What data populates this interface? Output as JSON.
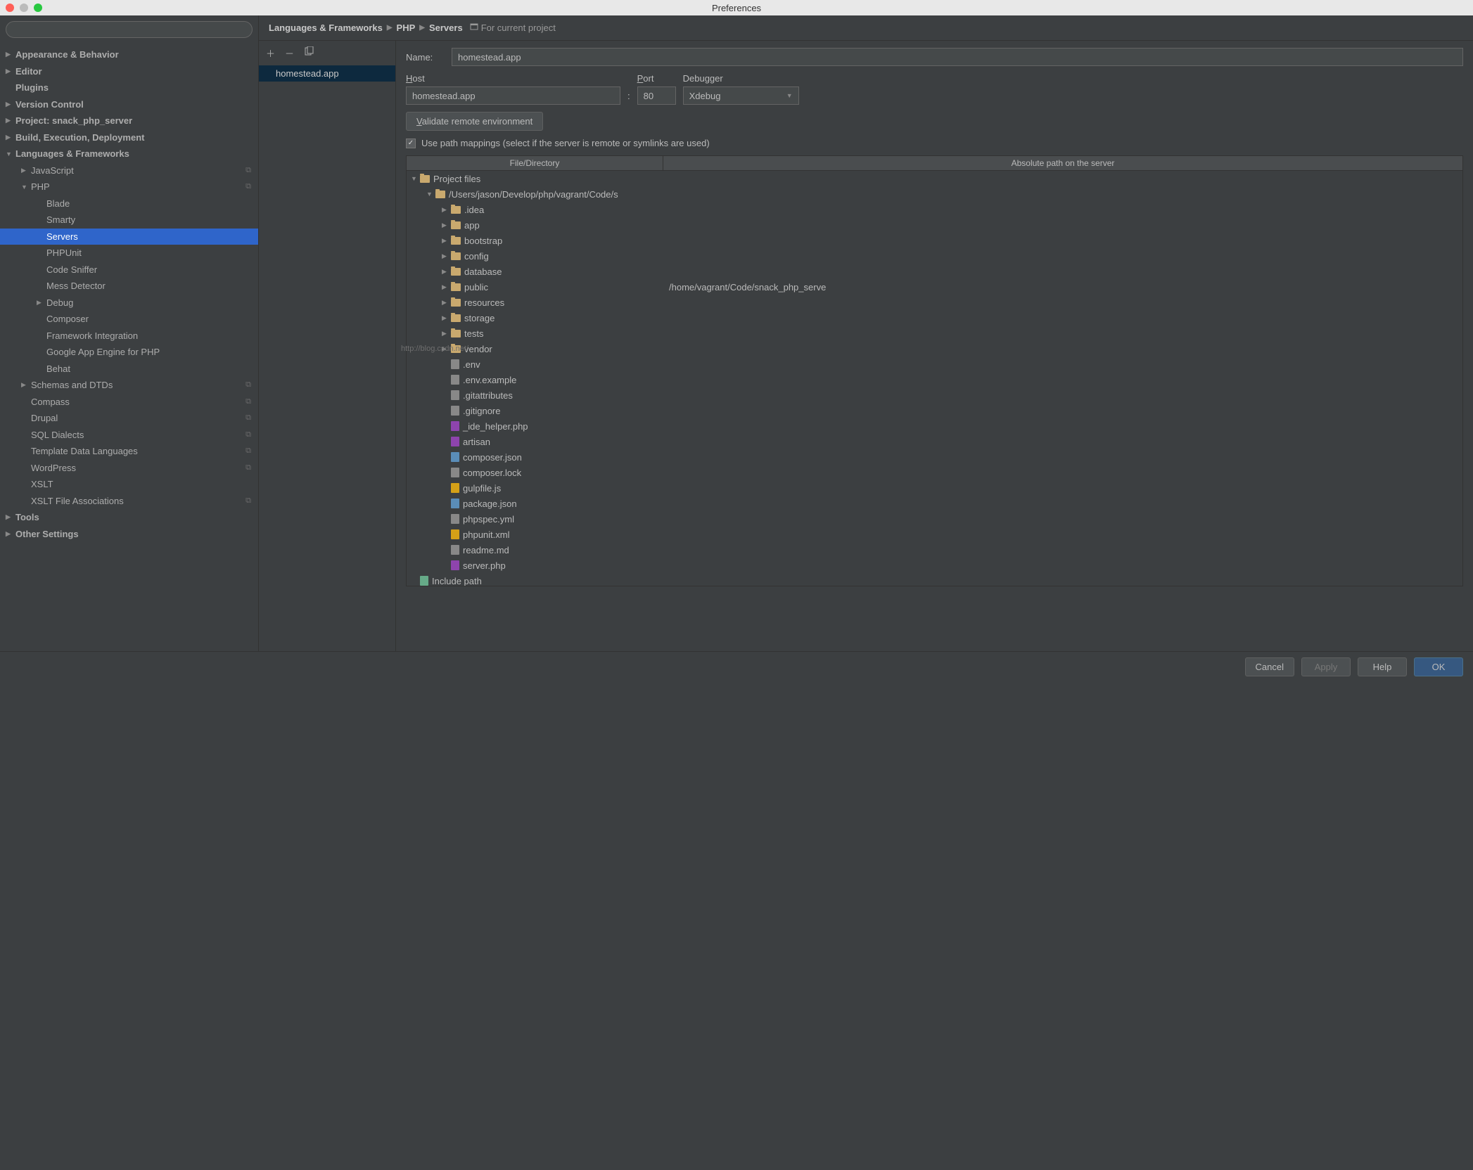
{
  "window": {
    "title": "Preferences"
  },
  "search": {
    "placeholder": ""
  },
  "sidebar": [
    {
      "label": "Appearance & Behavior",
      "indent": 0,
      "arrow": "right",
      "bold": true
    },
    {
      "label": "Editor",
      "indent": 0,
      "arrow": "right",
      "bold": true
    },
    {
      "label": "Plugins",
      "indent": 0,
      "arrow": "none",
      "bold": true
    },
    {
      "label": "Version Control",
      "indent": 0,
      "arrow": "right",
      "bold": true
    },
    {
      "label": "Project: snack_php_server",
      "indent": 0,
      "arrow": "right",
      "bold": true
    },
    {
      "label": "Build, Execution, Deployment",
      "indent": 0,
      "arrow": "right",
      "bold": true
    },
    {
      "label": "Languages & Frameworks",
      "indent": 0,
      "arrow": "down",
      "bold": true
    },
    {
      "label": "JavaScript",
      "indent": 1,
      "arrow": "right",
      "badge": true
    },
    {
      "label": "PHP",
      "indent": 1,
      "arrow": "down",
      "badge": true
    },
    {
      "label": "Blade",
      "indent": 2,
      "arrow": "none"
    },
    {
      "label": "Smarty",
      "indent": 2,
      "arrow": "none"
    },
    {
      "label": "Servers",
      "indent": 2,
      "arrow": "none",
      "selected": true
    },
    {
      "label": "PHPUnit",
      "indent": 2,
      "arrow": "none"
    },
    {
      "label": "Code Sniffer",
      "indent": 2,
      "arrow": "none"
    },
    {
      "label": "Mess Detector",
      "indent": 2,
      "arrow": "none"
    },
    {
      "label": "Debug",
      "indent": 2,
      "arrow": "right"
    },
    {
      "label": "Composer",
      "indent": 2,
      "arrow": "none"
    },
    {
      "label": "Framework Integration",
      "indent": 2,
      "arrow": "none"
    },
    {
      "label": "Google App Engine for PHP",
      "indent": 2,
      "arrow": "none"
    },
    {
      "label": "Behat",
      "indent": 2,
      "arrow": "none"
    },
    {
      "label": "Schemas and DTDs",
      "indent": 1,
      "arrow": "right",
      "badge": true
    },
    {
      "label": "Compass",
      "indent": 1,
      "arrow": "none",
      "badge": true
    },
    {
      "label": "Drupal",
      "indent": 1,
      "arrow": "none",
      "badge": true
    },
    {
      "label": "SQL Dialects",
      "indent": 1,
      "arrow": "none",
      "badge": true
    },
    {
      "label": "Template Data Languages",
      "indent": 1,
      "arrow": "none",
      "badge": true
    },
    {
      "label": "WordPress",
      "indent": 1,
      "arrow": "none",
      "badge": true
    },
    {
      "label": "XSLT",
      "indent": 1,
      "arrow": "none"
    },
    {
      "label": "XSLT File Associations",
      "indent": 1,
      "arrow": "none",
      "badge": true
    },
    {
      "label": "Tools",
      "indent": 0,
      "arrow": "right",
      "bold": true
    },
    {
      "label": "Other Settings",
      "indent": 0,
      "arrow": "right",
      "bold": true
    }
  ],
  "breadcrumb": {
    "parts": [
      "Languages & Frameworks",
      "PHP",
      "Servers"
    ],
    "scope": "For current project"
  },
  "servers": {
    "items": [
      "homestead.app"
    ]
  },
  "form": {
    "name_label": "Name:",
    "name_value": "homestead.app",
    "host_label": "Host",
    "host_value": "homestead.app",
    "port_label": "Port",
    "port_value": "80",
    "debugger_label": "Debugger",
    "debugger_value": "Xdebug",
    "validate_btn": "Validate remote environment",
    "use_mappings_label": "Use path mappings (select if the server is remote or symlinks are used)",
    "col1": "File/Directory",
    "col2": "Absolute path on the server",
    "colon": ":"
  },
  "filetree": [
    {
      "name": "Project files",
      "depth": 0,
      "arrow": "down",
      "icon": "folder"
    },
    {
      "name": "/Users/jason/Develop/php/vagrant/Code/s",
      "depth": 1,
      "arrow": "down",
      "icon": "folder"
    },
    {
      "name": ".idea",
      "depth": 2,
      "arrow": "right",
      "icon": "folder"
    },
    {
      "name": "app",
      "depth": 2,
      "arrow": "right",
      "icon": "folder"
    },
    {
      "name": "bootstrap",
      "depth": 2,
      "arrow": "right",
      "icon": "folder"
    },
    {
      "name": "config",
      "depth": 2,
      "arrow": "right",
      "icon": "folder"
    },
    {
      "name": "database",
      "depth": 2,
      "arrow": "right",
      "icon": "folder"
    },
    {
      "name": "public",
      "depth": 2,
      "arrow": "right",
      "icon": "folder",
      "mapping": "/home/vagrant/Code/snack_php_serve"
    },
    {
      "name": "resources",
      "depth": 2,
      "arrow": "right",
      "icon": "folder"
    },
    {
      "name": "storage",
      "depth": 2,
      "arrow": "right",
      "icon": "folder"
    },
    {
      "name": "tests",
      "depth": 2,
      "arrow": "right",
      "icon": "folder"
    },
    {
      "name": "vendor",
      "depth": 2,
      "arrow": "right",
      "icon": "folder"
    },
    {
      "name": ".env",
      "depth": 2,
      "arrow": "none",
      "icon": "txt"
    },
    {
      "name": ".env.example",
      "depth": 2,
      "arrow": "none",
      "icon": "txt"
    },
    {
      "name": ".gitattributes",
      "depth": 2,
      "arrow": "none",
      "icon": "txt"
    },
    {
      "name": ".gitignore",
      "depth": 2,
      "arrow": "none",
      "icon": "txt"
    },
    {
      "name": "_ide_helper.php",
      "depth": 2,
      "arrow": "none",
      "icon": "php"
    },
    {
      "name": "artisan",
      "depth": 2,
      "arrow": "none",
      "icon": "php"
    },
    {
      "name": "composer.json",
      "depth": 2,
      "arrow": "none",
      "icon": "json"
    },
    {
      "name": "composer.lock",
      "depth": 2,
      "arrow": "none",
      "icon": "txt"
    },
    {
      "name": "gulpfile.js",
      "depth": 2,
      "arrow": "none",
      "icon": "js"
    },
    {
      "name": "package.json",
      "depth": 2,
      "arrow": "none",
      "icon": "json"
    },
    {
      "name": "phpspec.yml",
      "depth": 2,
      "arrow": "none",
      "icon": "txt"
    },
    {
      "name": "phpunit.xml",
      "depth": 2,
      "arrow": "none",
      "icon": "js"
    },
    {
      "name": "readme.md",
      "depth": 2,
      "arrow": "none",
      "icon": "txt"
    },
    {
      "name": "server.php",
      "depth": 2,
      "arrow": "none",
      "icon": "php"
    },
    {
      "name": "Include path",
      "depth": 0,
      "arrow": "none",
      "icon": "include"
    }
  ],
  "footer": {
    "cancel": "Cancel",
    "apply": "Apply",
    "help": "Help",
    "ok": "OK"
  },
  "watermark": "http://blog.csdn.net/"
}
